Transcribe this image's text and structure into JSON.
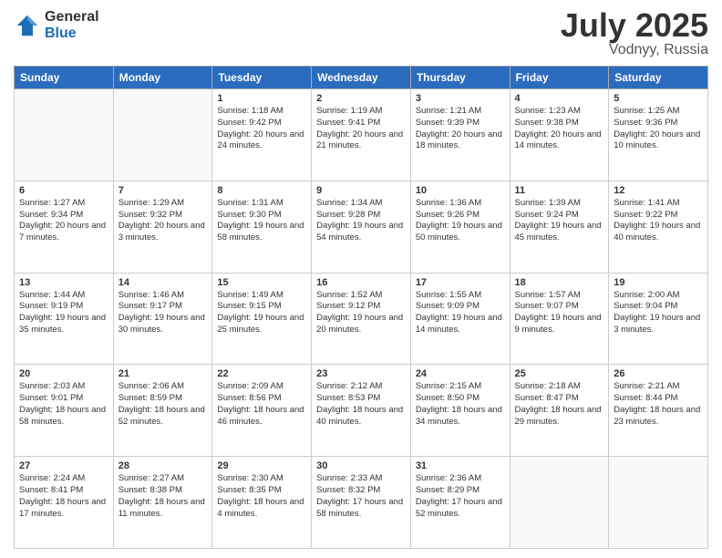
{
  "header": {
    "logo_general": "General",
    "logo_blue": "Blue",
    "month_title": "July 2025",
    "location": "Vodnyy, Russia"
  },
  "weekdays": [
    "Sunday",
    "Monday",
    "Tuesday",
    "Wednesday",
    "Thursday",
    "Friday",
    "Saturday"
  ],
  "weeks": [
    [
      {
        "day": "",
        "info": ""
      },
      {
        "day": "",
        "info": ""
      },
      {
        "day": "1",
        "info": "Sunrise: 1:18 AM\nSunset: 9:42 PM\nDaylight: 20 hours and 24 minutes."
      },
      {
        "day": "2",
        "info": "Sunrise: 1:19 AM\nSunset: 9:41 PM\nDaylight: 20 hours and 21 minutes."
      },
      {
        "day": "3",
        "info": "Sunrise: 1:21 AM\nSunset: 9:39 PM\nDaylight: 20 hours and 18 minutes."
      },
      {
        "day": "4",
        "info": "Sunrise: 1:23 AM\nSunset: 9:38 PM\nDaylight: 20 hours and 14 minutes."
      },
      {
        "day": "5",
        "info": "Sunrise: 1:25 AM\nSunset: 9:36 PM\nDaylight: 20 hours and 10 minutes."
      }
    ],
    [
      {
        "day": "6",
        "info": "Sunrise: 1:27 AM\nSunset: 9:34 PM\nDaylight: 20 hours and 7 minutes."
      },
      {
        "day": "7",
        "info": "Sunrise: 1:29 AM\nSunset: 9:32 PM\nDaylight: 20 hours and 3 minutes."
      },
      {
        "day": "8",
        "info": "Sunrise: 1:31 AM\nSunset: 9:30 PM\nDaylight: 19 hours and 58 minutes."
      },
      {
        "day": "9",
        "info": "Sunrise: 1:34 AM\nSunset: 9:28 PM\nDaylight: 19 hours and 54 minutes."
      },
      {
        "day": "10",
        "info": "Sunrise: 1:36 AM\nSunset: 9:26 PM\nDaylight: 19 hours and 50 minutes."
      },
      {
        "day": "11",
        "info": "Sunrise: 1:39 AM\nSunset: 9:24 PM\nDaylight: 19 hours and 45 minutes."
      },
      {
        "day": "12",
        "info": "Sunrise: 1:41 AM\nSunset: 9:22 PM\nDaylight: 19 hours and 40 minutes."
      }
    ],
    [
      {
        "day": "13",
        "info": "Sunrise: 1:44 AM\nSunset: 9:19 PM\nDaylight: 19 hours and 35 minutes."
      },
      {
        "day": "14",
        "info": "Sunrise: 1:46 AM\nSunset: 9:17 PM\nDaylight: 19 hours and 30 minutes."
      },
      {
        "day": "15",
        "info": "Sunrise: 1:49 AM\nSunset: 9:15 PM\nDaylight: 19 hours and 25 minutes."
      },
      {
        "day": "16",
        "info": "Sunrise: 1:52 AM\nSunset: 9:12 PM\nDaylight: 19 hours and 20 minutes."
      },
      {
        "day": "17",
        "info": "Sunrise: 1:55 AM\nSunset: 9:09 PM\nDaylight: 19 hours and 14 minutes."
      },
      {
        "day": "18",
        "info": "Sunrise: 1:57 AM\nSunset: 9:07 PM\nDaylight: 19 hours and 9 minutes."
      },
      {
        "day": "19",
        "info": "Sunrise: 2:00 AM\nSunset: 9:04 PM\nDaylight: 19 hours and 3 minutes."
      }
    ],
    [
      {
        "day": "20",
        "info": "Sunrise: 2:03 AM\nSunset: 9:01 PM\nDaylight: 18 hours and 58 minutes."
      },
      {
        "day": "21",
        "info": "Sunrise: 2:06 AM\nSunset: 8:59 PM\nDaylight: 18 hours and 52 minutes."
      },
      {
        "day": "22",
        "info": "Sunrise: 2:09 AM\nSunset: 8:56 PM\nDaylight: 18 hours and 46 minutes."
      },
      {
        "day": "23",
        "info": "Sunrise: 2:12 AM\nSunset: 8:53 PM\nDaylight: 18 hours and 40 minutes."
      },
      {
        "day": "24",
        "info": "Sunrise: 2:15 AM\nSunset: 8:50 PM\nDaylight: 18 hours and 34 minutes."
      },
      {
        "day": "25",
        "info": "Sunrise: 2:18 AM\nSunset: 8:47 PM\nDaylight: 18 hours and 29 minutes."
      },
      {
        "day": "26",
        "info": "Sunrise: 2:21 AM\nSunset: 8:44 PM\nDaylight: 18 hours and 23 minutes."
      }
    ],
    [
      {
        "day": "27",
        "info": "Sunrise: 2:24 AM\nSunset: 8:41 PM\nDaylight: 18 hours and 17 minutes."
      },
      {
        "day": "28",
        "info": "Sunrise: 2:27 AM\nSunset: 8:38 PM\nDaylight: 18 hours and 11 minutes."
      },
      {
        "day": "29",
        "info": "Sunrise: 2:30 AM\nSunset: 8:35 PM\nDaylight: 18 hours and 4 minutes."
      },
      {
        "day": "30",
        "info": "Sunrise: 2:33 AM\nSunset: 8:32 PM\nDaylight: 17 hours and 58 minutes."
      },
      {
        "day": "31",
        "info": "Sunrise: 2:36 AM\nSunset: 8:29 PM\nDaylight: 17 hours and 52 minutes."
      },
      {
        "day": "",
        "info": ""
      },
      {
        "day": "",
        "info": ""
      }
    ]
  ]
}
